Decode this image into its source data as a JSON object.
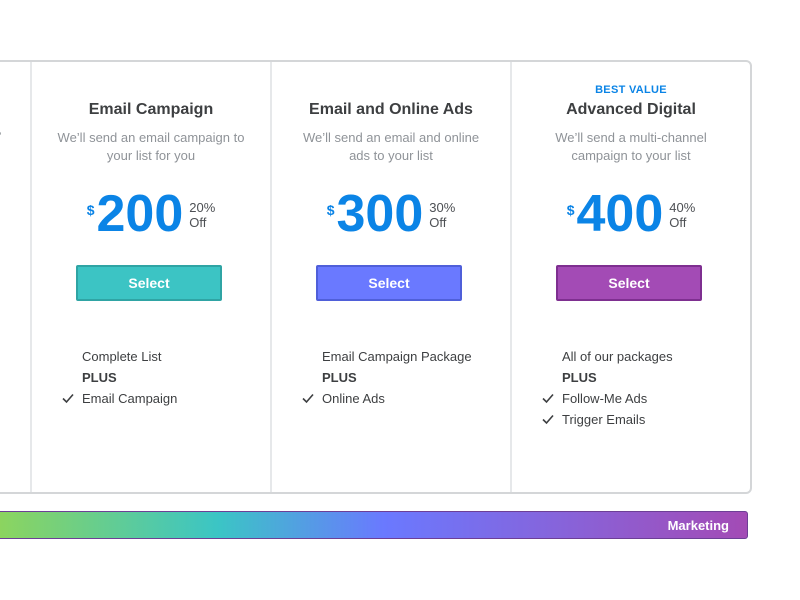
{
  "plans": [
    {
      "badge": "",
      "title": "Email Campaign",
      "description": "We’ll send an email campaign to your list for you",
      "currency": "$",
      "price": "200",
      "discount_pct": "20%",
      "discount_word": "Off",
      "button_label": "Select",
      "button_color": "#3cc4c4",
      "features": [
        {
          "text": "Complete List",
          "check": false
        },
        {
          "text": "PLUS",
          "check": false
        },
        {
          "text": "Email Campaign",
          "check": true
        }
      ]
    },
    {
      "badge": "",
      "title": "Email and Online Ads",
      "description": "We’ll send an email and online ads to your list",
      "currency": "$",
      "price": "300",
      "discount_pct": "30%",
      "discount_word": "Off",
      "button_label": "Select",
      "button_color": "#6a79ff",
      "features": [
        {
          "text": "Email Campaign Package",
          "check": false
        },
        {
          "text": "PLUS",
          "check": false
        },
        {
          "text": "Online Ads",
          "check": true
        }
      ]
    },
    {
      "badge": "BEST VALUE",
      "title": "Advanced Digital",
      "description": "We’ll send a multi-channel campaign to your list",
      "currency": "$",
      "price": "400",
      "discount_pct": "40%",
      "discount_word": "Off",
      "button_label": "Select",
      "button_color": "#a34bb5",
      "features": [
        {
          "text": "All of our packages",
          "check": false
        },
        {
          "text": "PLUS",
          "check": false
        },
        {
          "text": "Follow-Me Ads",
          "check": true
        },
        {
          "text": "Trigger Emails",
          "check": true
        }
      ]
    }
  ],
  "category_bar": {
    "label": "Marketing"
  },
  "colors": {
    "price_blue": "#0b84e6",
    "border_gray": "#d4d6d8",
    "text_dark": "#3d3f41",
    "text_muted": "#8f9398"
  },
  "icons": {
    "feature_check": "check-icon"
  }
}
